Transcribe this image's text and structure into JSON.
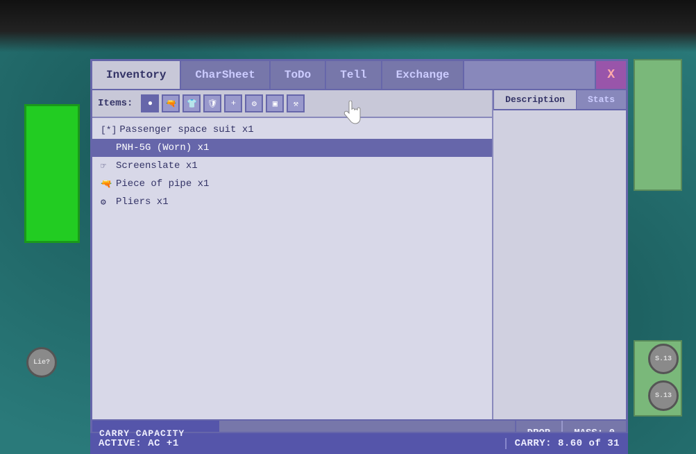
{
  "tabs": [
    {
      "id": "inventory",
      "label": "Inventory",
      "active": true
    },
    {
      "id": "charsheet",
      "label": "CharSheet",
      "active": false
    },
    {
      "id": "todo",
      "label": "ToDo",
      "active": false
    },
    {
      "id": "tell",
      "label": "Tell",
      "active": false
    },
    {
      "id": "exchange",
      "label": "Exchange",
      "active": false
    }
  ],
  "close_button": "X",
  "filter": {
    "label": "Items:",
    "icons": [
      "●",
      "🔫",
      "👕",
      "🛡",
      "💊",
      "🔧",
      "📱",
      "🔨"
    ]
  },
  "items": [
    {
      "id": 1,
      "icon": "[*]",
      "name": "Passenger space suit x1",
      "selected": false
    },
    {
      "id": 2,
      "icon": "",
      "name": "PNH-5G (Worn) x1",
      "selected": true
    },
    {
      "id": 3,
      "icon": "☞",
      "name": "Screenslate x1",
      "selected": false
    },
    {
      "id": 4,
      "icon": "🔫",
      "name": "Piece of pipe x1",
      "selected": false
    },
    {
      "id": 5,
      "icon": "⚙",
      "name": "Pliers x1",
      "selected": false
    }
  ],
  "desc_tabs": [
    {
      "id": "description",
      "label": "Description",
      "active": true
    },
    {
      "id": "stats",
      "label": "Stats",
      "active": false
    }
  ],
  "carry_capacity_label": "CARRY CAPACITY",
  "drop_label": "DROP",
  "mass_label": "MASS: 0",
  "status": {
    "left": "ACTIVE:  AC +1",
    "right": "CARRY: 8.60 of 31"
  },
  "badges": [
    "S.13",
    "S.13"
  ],
  "lie_badge": "Lie?"
}
